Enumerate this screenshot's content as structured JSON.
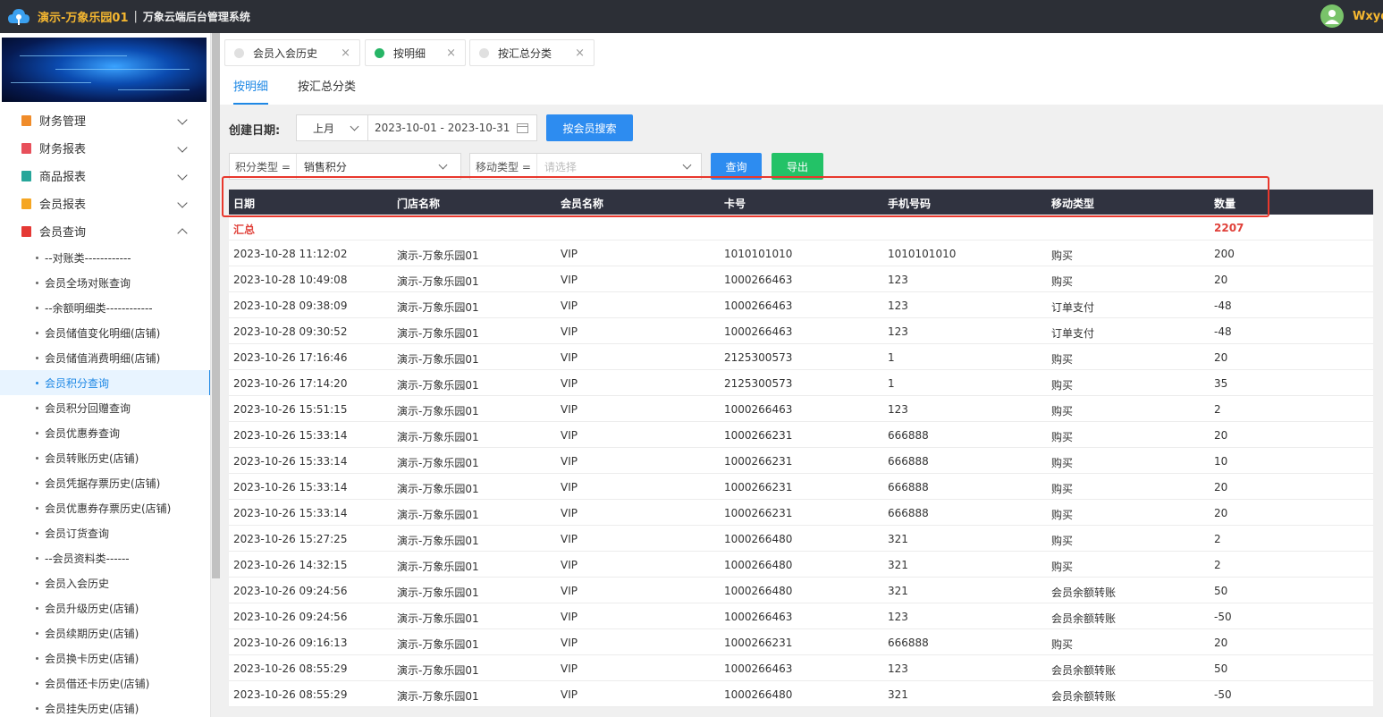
{
  "topbar": {
    "brand": "演示-万象乐园01",
    "separator": "|",
    "system_name": "万象云端后台管理系统",
    "username": "Wxyd"
  },
  "sidebar": {
    "groups": [
      {
        "label": "财务管理",
        "color": "#f08c2a"
      },
      {
        "label": "财务报表",
        "color": "#e8505b"
      },
      {
        "label": "商品报表",
        "color": "#26a69a"
      },
      {
        "label": "会员报表",
        "color": "#f5a623"
      },
      {
        "label": "会员查询",
        "color": "#e53935"
      }
    ],
    "items": [
      "--对账类------------",
      "会员全场对账查询",
      "--余额明细类------------",
      "会员储值变化明细(店铺)",
      "会员储值消费明细(店铺)",
      "会员积分查询",
      "会员积分回赠查询",
      "会员优惠券查询",
      "会员转账历史(店铺)",
      "会员凭据存票历史(店铺)",
      "会员优惠券存票历史(店铺)",
      "会员订货查询",
      "--会员资料类------",
      "会员入会历史",
      "会员升级历史(店铺)",
      "会员续期历史(店铺)",
      "会员换卡历史(店铺)",
      "会员借还卡历史(店铺)",
      "会员挂失历史(店铺)"
    ]
  },
  "tabs": [
    {
      "label": "会员入会历史",
      "close": "×"
    },
    {
      "label": "按明细",
      "close": "×"
    },
    {
      "label": "按汇总分类",
      "close": "×"
    }
  ],
  "subtabs": [
    "按明细",
    "按汇总分类"
  ],
  "filters": {
    "date_label": "创建日期:",
    "period": "上月",
    "date_range": "2023-10-01 - 2023-10-31",
    "member_search": "按会员搜索",
    "points_type_label": "积分类型 =",
    "points_type_value": "销售积分",
    "move_type_label": "移动类型 =",
    "move_type_placeholder": "请选择",
    "query": "查询",
    "export": "导出"
  },
  "table": {
    "headers": [
      "日期",
      "门店名称",
      "会员名称",
      "卡号",
      "手机号码",
      "移动类型",
      "数量"
    ],
    "total_label": "汇总",
    "total_value": "2207",
    "rows": [
      [
        "2023-10-28 11:12:02",
        "演示-万象乐园01",
        "VIP",
        "1010101010",
        "1010101010",
        "购买",
        "200"
      ],
      [
        "2023-10-28 10:49:08",
        "演示-万象乐园01",
        "VIP",
        "1000266463",
        "123",
        "购买",
        "20"
      ],
      [
        "2023-10-28 09:38:09",
        "演示-万象乐园01",
        "VIP",
        "1000266463",
        "123",
        "订单支付",
        "-48"
      ],
      [
        "2023-10-28 09:30:52",
        "演示-万象乐园01",
        "VIP",
        "1000266463",
        "123",
        "订单支付",
        "-48"
      ],
      [
        "2023-10-26 17:16:46",
        "演示-万象乐园01",
        "VIP",
        "2125300573",
        "1",
        "购买",
        "20"
      ],
      [
        "2023-10-26 17:14:20",
        "演示-万象乐园01",
        "VIP",
        "2125300573",
        "1",
        "购买",
        "35"
      ],
      [
        "2023-10-26 15:51:15",
        "演示-万象乐园01",
        "VIP",
        "1000266463",
        "123",
        "购买",
        "2"
      ],
      [
        "2023-10-26 15:33:14",
        "演示-万象乐园01",
        "VIP",
        "1000266231",
        "666888",
        "购买",
        "20"
      ],
      [
        "2023-10-26 15:33:14",
        "演示-万象乐园01",
        "VIP",
        "1000266231",
        "666888",
        "购买",
        "10"
      ],
      [
        "2023-10-26 15:33:14",
        "演示-万象乐园01",
        "VIP",
        "1000266231",
        "666888",
        "购买",
        "20"
      ],
      [
        "2023-10-26 15:33:14",
        "演示-万象乐园01",
        "VIP",
        "1000266231",
        "666888",
        "购买",
        "20"
      ],
      [
        "2023-10-26 15:27:25",
        "演示-万象乐园01",
        "VIP",
        "1000266480",
        "321",
        "购买",
        "2"
      ],
      [
        "2023-10-26 14:32:15",
        "演示-万象乐园01",
        "VIP",
        "1000266480",
        "321",
        "购买",
        "2"
      ],
      [
        "2023-10-26 09:24:56",
        "演示-万象乐园01",
        "VIP",
        "1000266480",
        "321",
        "会员余额转账",
        "50"
      ],
      [
        "2023-10-26 09:24:56",
        "演示-万象乐园01",
        "VIP",
        "1000266463",
        "123",
        "会员余额转账",
        "-50"
      ],
      [
        "2023-10-26 09:16:13",
        "演示-万象乐园01",
        "VIP",
        "1000266231",
        "666888",
        "购买",
        "20"
      ],
      [
        "2023-10-26 08:55:29",
        "演示-万象乐园01",
        "VIP",
        "1000266463",
        "123",
        "会员余额转账",
        "50"
      ],
      [
        "2023-10-26 08:55:29",
        "演示-万象乐园01",
        "VIP",
        "1000266480",
        "321",
        "会员余额转账",
        "-50"
      ]
    ]
  }
}
